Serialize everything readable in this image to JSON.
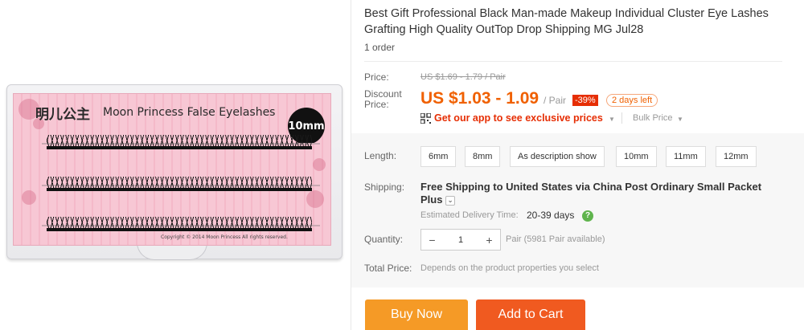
{
  "product": {
    "title": "Best Gift Professional Black Man-made Makeup Individual Cluster Eye Lashes Grafting High Quality OutTop Drop Shipping MG Jul28",
    "orders": "1 order"
  },
  "image": {
    "brand_cn": "明儿公主",
    "brand_en": "Moon Princess False Eyelashes",
    "size_badge": "10mm",
    "copyright": "Copyright © 2014 Moon Princess All rights reserved."
  },
  "price": {
    "label": "Price:",
    "original": "US $1.69 - 1.79 / Pair",
    "discount_label_1": "Discount",
    "discount_label_2": "Price:",
    "sale": "US $1.03 - 1.09",
    "unit": "/ Pair",
    "discount_badge": "-39%",
    "days_left": "2 days left",
    "app_promo": "Get our app to see exclusive prices",
    "bulk": "Bulk Price"
  },
  "length": {
    "label": "Length:",
    "options": [
      "6mm",
      "8mm",
      "As description show",
      "10mm",
      "11mm",
      "12mm"
    ]
  },
  "shipping": {
    "label": "Shipping:",
    "line1": "Free Shipping to United States via China Post Ordinary Small Packet",
    "line2": "Plus",
    "est_label": "Estimated Delivery Time:",
    "est_value": "20-39 days",
    "help_glyph": "?"
  },
  "quantity": {
    "label": "Quantity:",
    "minus": "−",
    "value": "1",
    "plus": "+",
    "note": "Pair (5981 Pair available)"
  },
  "total": {
    "label": "Total Price:",
    "note": "Depends on the product properties you select"
  },
  "actions": {
    "buy_now": "Buy Now",
    "add_to_cart": "Add to Cart"
  },
  "colors": {
    "accent": "#f06000",
    "buy": "#f59a26",
    "cart": "#f05a20",
    "promo": "#e62e04"
  }
}
